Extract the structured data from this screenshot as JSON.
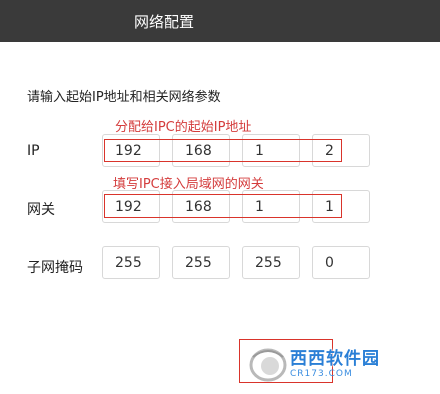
{
  "window": {
    "title": "网络配置"
  },
  "instruction": "请输入起始IP地址和相关网络参数",
  "hints": {
    "ip": "分配给IPC的起始IP地址",
    "gateway": "填写IPC接入局域网的网关"
  },
  "rows": {
    "ip": {
      "label": "IP",
      "octets": [
        "192",
        "168",
        "1",
        "2"
      ]
    },
    "gateway": {
      "label": "网关",
      "octets": [
        "192",
        "168",
        "1",
        "1"
      ]
    },
    "mask": {
      "label": "子网掩码",
      "octets": [
        "255",
        "255",
        "255",
        "0"
      ]
    }
  },
  "watermark": {
    "brand": "西西软件园",
    "url": "CR173.COM"
  },
  "colors": {
    "titlebar": "#3a3a3a",
    "hint": "#d43c3c",
    "highlight_border": "#d9342b"
  }
}
